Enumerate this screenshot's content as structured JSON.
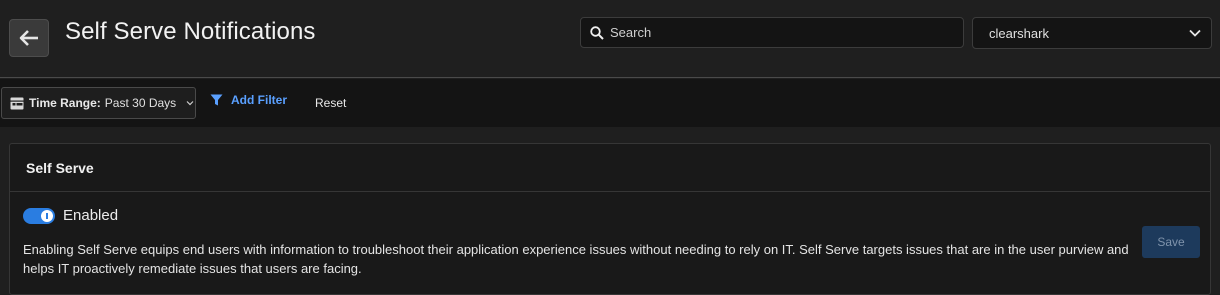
{
  "header": {
    "title": "Self Serve Notifications",
    "search_placeholder": "Search",
    "org_selected": "clearshark"
  },
  "filters": {
    "time_range_label": "Time Range:",
    "time_range_value": "Past 30 Days",
    "add_filter_label": "Add Filter",
    "reset_label": "Reset"
  },
  "panel": {
    "title": "Self Serve",
    "toggle_label": "Enabled",
    "toggle_on": true,
    "description": "Enabling Self Serve equips end users with information to troubleshoot their application experience issues without needing to rely on IT. Self Serve targets issues that are in the user purview and helps IT proactively remediate issues that users are facing.",
    "save_label": "Save"
  },
  "colors": {
    "accent": "#2a7de1",
    "link": "#5aa0ff",
    "background": "#1f1f1f"
  },
  "icons": [
    "back-arrow-icon",
    "search-icon",
    "chevron-down-icon",
    "calendar-icon",
    "filter-icon"
  ]
}
